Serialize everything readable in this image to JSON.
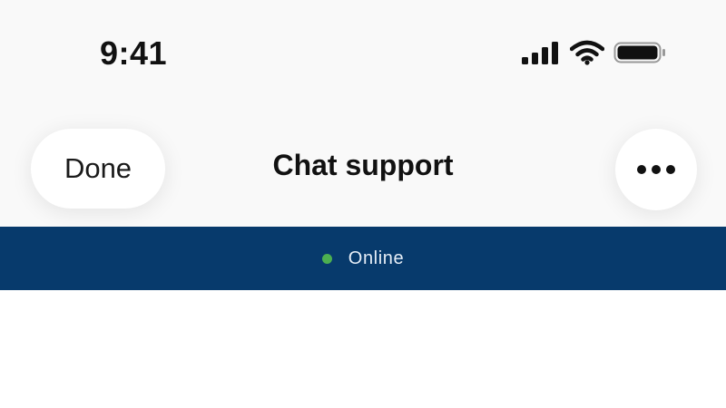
{
  "status_bar": {
    "time": "9:41",
    "icons": [
      "cellular-signal-icon",
      "wifi-icon",
      "battery-icon"
    ]
  },
  "header": {
    "done_label": "Done",
    "title": "Chat support",
    "more_icon": "more-horizontal-icon"
  },
  "banner": {
    "status_text": "Online",
    "status_color": "#4caf50",
    "background_color": "#073a6c"
  }
}
